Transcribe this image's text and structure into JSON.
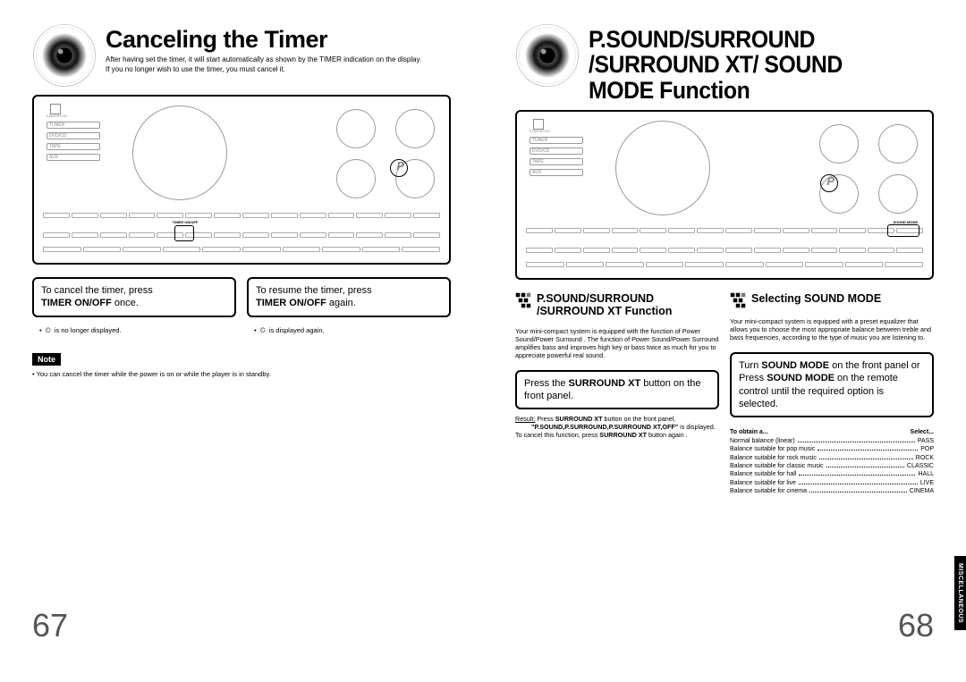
{
  "left": {
    "title": "Canceling the Timer",
    "intro1": "After having set the timer, it will start automatically as shown by the TIMER indication on the display.",
    "intro2": "If you no longer wish to use the timer, you must cancel it.",
    "cancel_caption_pre": "To cancel the timer, press ",
    "cancel_caption_bold": "TIMER ON/OFF",
    "cancel_caption_post": " once.",
    "cancel_note": " is no longer displayed.",
    "resume_caption_pre": "To resume the timer, press ",
    "resume_caption_bold": "TIMER ON/OFF",
    "resume_caption_post": " again.",
    "resume_note": " is displayed again.",
    "note_label": "Note",
    "note_body": "• You can cancel the timer while the power is on or while the player is in standby.",
    "page_num": "67"
  },
  "right": {
    "title": "P.SOUND/SURROUND /SURROUND XT/ SOUND MODE Function",
    "sec1_title": "P.SOUND/SURROUND /SURROUND XT Function",
    "sec1_body": "Your mini-compact system is equipped with the function of Power Sound/Power Surround . The function of Power Sound/Power Surround amplifies bass and improves high key or bass twice as much for you to appreciate powerful real sound.",
    "sec1_frame_pre": "Press the ",
    "sec1_frame_bold": "SURROUND XT",
    "sec1_frame_post": " button on the front panel.",
    "sec1_result_label": "Result:",
    "sec1_result_1a": " Press ",
    "sec1_result_1b": "SURROUND XT",
    "sec1_result_1c": " button on the front panel,",
    "sec1_result_2": "\"P.SOUND,P.SURROUND,P.SURROUND XT,OFF\"",
    "sec1_result_2b": " is displayed.",
    "sec1_result_3a": "To cancel this function, press ",
    "sec1_result_3b": "SURROUND XT",
    "sec1_result_3c": " button again .",
    "sec2_title": "Selecting SOUND MODE",
    "sec2_body": "Your mini-compact system is equipped with a preset equalizer that allows you to choose the most appropriate balance between treble and bass frequencies, according to the type of music you are listening to.",
    "sec2_frame_1a": "Turn ",
    "sec2_frame_1b": "SOUND MODE",
    "sec2_frame_1c": " on the front panel or",
    "sec2_frame_2a": "Press ",
    "sec2_frame_2b": "SOUND MODE",
    "sec2_frame_2c": " on the remote control until the required option is selected.",
    "table_h1": "To obtain a...",
    "table_h2": "Select...",
    "options": [
      {
        "l": "Normal balance (linear)",
        "r": "PASS"
      },
      {
        "l": "Balance suitable for pop music",
        "r": "POP"
      },
      {
        "l": "Balance suitable for rock music",
        "r": "ROCK"
      },
      {
        "l": "Balance suitable for classic music",
        "r": "CLASSIC"
      },
      {
        "l": "Balance suitable for hall",
        "r": "HALL"
      },
      {
        "l": "Balance suitable for live",
        "r": "LIVE"
      },
      {
        "l": "Balance suitable for cinema",
        "r": "CINEMA"
      }
    ],
    "side_tab": "MISCELLANEOUS",
    "page_num": "68"
  },
  "device_labels": {
    "standby": "STANDBY/ON",
    "tuner": "TUNER",
    "dvdcd": "DVD/CD",
    "tape": "TAPE",
    "aux": "AUX",
    "timer_onoff": "TIMER ON/OFF",
    "sound_mode": "SOUND MODE",
    "p_letter": "P"
  }
}
